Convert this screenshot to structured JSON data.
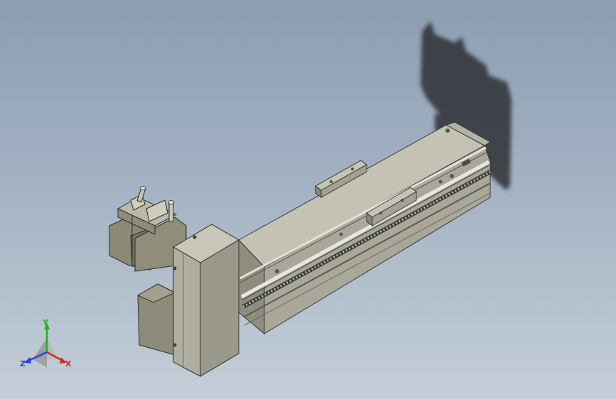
{
  "viewport": {
    "background_top": "#8b9db1",
    "background_bottom": "#c4ced8"
  },
  "model": {
    "body_color": "#aaa89c",
    "top_face_color": "#c2c0b3",
    "dark_face_color": "#6f6e64",
    "motor_color": "#8f8c7b",
    "shadow_color": "#2e3236"
  },
  "triad": {
    "x_label": "X",
    "y_label": "Y",
    "z_label": "Z",
    "x_color": "#d22a2a",
    "y_color": "#23b023",
    "z_color": "#2a3fd8"
  }
}
